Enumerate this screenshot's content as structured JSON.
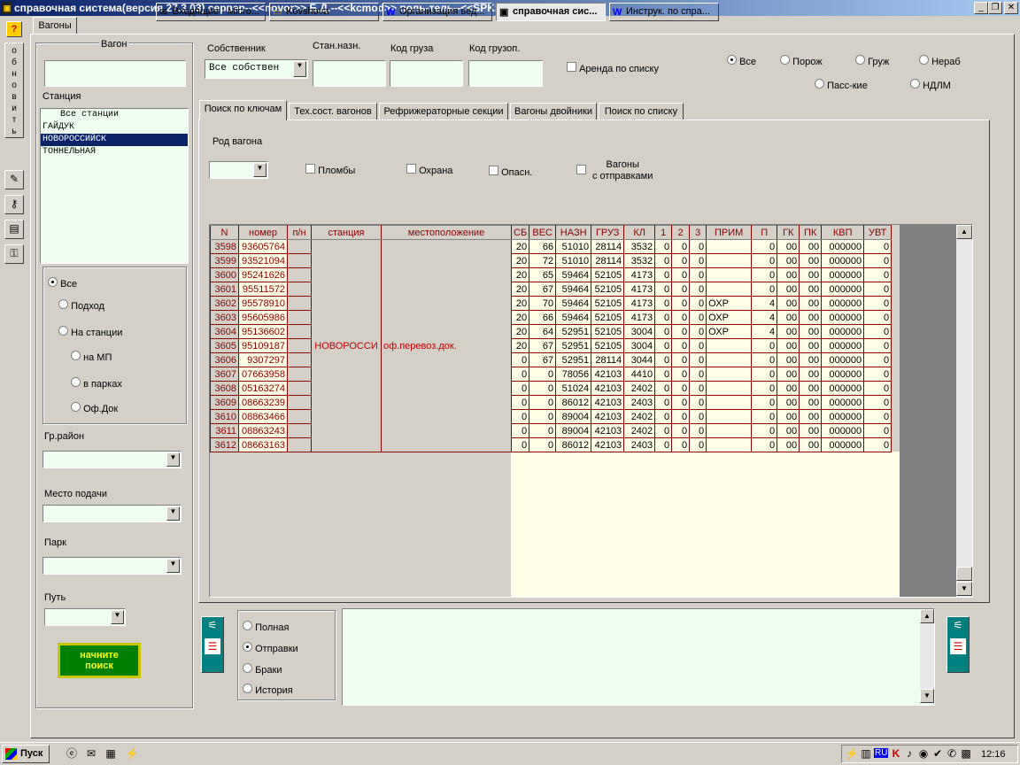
{
  "window": {
    "title": "справочная система(версия 27.3.03) сервер--<<novor>> Б.Д.--<<kcmod>> поль-тель--<<SPKS>>"
  },
  "main_tab": "Вагоны",
  "side_toolbar": {
    "help": "?",
    "refresh": "о б н о в и т ь"
  },
  "left": {
    "wagon_label": "Вагон",
    "station_label": "Станция",
    "stations": [
      "Все станции",
      "ГАЙДУК",
      "НОВОРОССИЙСК",
      "ТОННЕЛЬНАЯ"
    ],
    "filter_radios": [
      "Все",
      "Подход",
      "На станции",
      "на МП",
      "в парках",
      "Оф.Док"
    ],
    "gr_raion": "Гр.район",
    "mesto": "Место подачи",
    "park": "Парк",
    "put": "Путь",
    "search_button": "начните поиск"
  },
  "top": {
    "owner_label": "Собственник",
    "owner_value": "Все собствен",
    "stan_label": "Стан.назн.",
    "kod_gruza": "Код груза",
    "kod_gruzop": "Код грузоп.",
    "arenda": "Аренда по списку",
    "radios": [
      "Все",
      "Порож",
      "Груж",
      "Нераб",
      "Пасс-кие",
      "НДЛМ"
    ]
  },
  "tabs": [
    "Поиск по ключам",
    "Тех.сост. вагонов",
    "Рефрижераторные секции",
    "Вагоны двойники",
    "Поиск по списку"
  ],
  "search": {
    "rod_label": "Род вагона",
    "plomby": "Пломбы",
    "ohrana": "Охрана",
    "opasn": "Опасн.",
    "vagony": "Вагоны",
    "s_otpr": "с отправками"
  },
  "table": {
    "headers": [
      "N",
      "номер",
      "п/н",
      "станция",
      "местоположение",
      "СБ",
      "ВЕС",
      "НАЗН",
      "ГРУЗ",
      "КЛ",
      "1",
      "2",
      "3",
      "ПРИМ",
      "П",
      "ГК",
      "ПК",
      "КВП",
      "УВТ"
    ],
    "station": "НОВОРОССИ",
    "location": "оф.перевоз.док.",
    "rows": [
      [
        "3598",
        "93605764",
        "20",
        "66",
        "51010",
        "28114",
        "3532",
        "0",
        "0",
        "0",
        "",
        "0",
        "00",
        "00",
        "000000",
        "0"
      ],
      [
        "3599",
        "93521094",
        "20",
        "72",
        "51010",
        "28114",
        "3532",
        "0",
        "0",
        "0",
        "",
        "0",
        "00",
        "00",
        "000000",
        "0"
      ],
      [
        "3600",
        "95241626",
        "20",
        "65",
        "59464",
        "52105",
        "4173",
        "0",
        "0",
        "0",
        "",
        "0",
        "00",
        "00",
        "000000",
        "0"
      ],
      [
        "3601",
        "95511572",
        "20",
        "67",
        "59464",
        "52105",
        "4173",
        "0",
        "0",
        "0",
        "",
        "0",
        "00",
        "00",
        "000000",
        "0"
      ],
      [
        "3602",
        "95578910",
        "20",
        "70",
        "59464",
        "52105",
        "4173",
        "0",
        "0",
        "0",
        "ОХР",
        "4",
        "00",
        "00",
        "000000",
        "0"
      ],
      [
        "3603",
        "95605986",
        "20",
        "66",
        "59464",
        "52105",
        "4173",
        "0",
        "0",
        "0",
        "ОХР",
        "4",
        "00",
        "00",
        "000000",
        "0"
      ],
      [
        "3604",
        "95136602",
        "20",
        "64",
        "52951",
        "52105",
        "3004",
        "0",
        "0",
        "0",
        "ОХР",
        "4",
        "00",
        "00",
        "000000",
        "0"
      ],
      [
        "3605",
        "95109187",
        "20",
        "67",
        "52951",
        "52105",
        "3004",
        "0",
        "0",
        "0",
        "",
        "0",
        "00",
        "00",
        "000000",
        "0"
      ],
      [
        "3606",
        "9307297",
        "0",
        "67",
        "52951",
        "28114",
        "3044",
        "0",
        "0",
        "0",
        "",
        "0",
        "00",
        "00",
        "000000",
        "0"
      ],
      [
        "3607",
        "07663958",
        "0",
        "0",
        "78056",
        "42103",
        "4410",
        "0",
        "0",
        "0",
        "",
        "0",
        "00",
        "00",
        "000000",
        "0"
      ],
      [
        "3608",
        "05163274",
        "0",
        "0",
        "51024",
        "42103",
        "2402",
        "0",
        "0",
        "0",
        "",
        "0",
        "00",
        "00",
        "000000",
        "0"
      ],
      [
        "3609",
        "08663239",
        "0",
        "0",
        "86012",
        "42103",
        "2403",
        "0",
        "0",
        "0",
        "",
        "0",
        "00",
        "00",
        "000000",
        "0"
      ],
      [
        "3610",
        "08863466",
        "0",
        "0",
        "89004",
        "42103",
        "2402",
        "0",
        "0",
        "0",
        "",
        "0",
        "00",
        "00",
        "000000",
        "0"
      ],
      [
        "3611",
        "08863243",
        "0",
        "0",
        "89004",
        "42103",
        "2402",
        "0",
        "0",
        "0",
        "",
        "0",
        "00",
        "00",
        "000000",
        "0"
      ],
      [
        "3612",
        "08663163",
        "0",
        "0",
        "86012",
        "42103",
        "2403",
        "0",
        "0",
        "0",
        "",
        "0",
        "00",
        "00",
        "000000",
        "0"
      ]
    ]
  },
  "bottom": {
    "radios": [
      "Полная",
      "Отправки",
      "Браки",
      "История"
    ]
  },
  "taskbar": {
    "start": "Пуск",
    "items": [
      "Входящие - Micro...",
      "Kovshova",
      "Организация вед...",
      "справочная сис...",
      "Инструк. по спра..."
    ],
    "lang": "RU",
    "time": "12:16"
  }
}
